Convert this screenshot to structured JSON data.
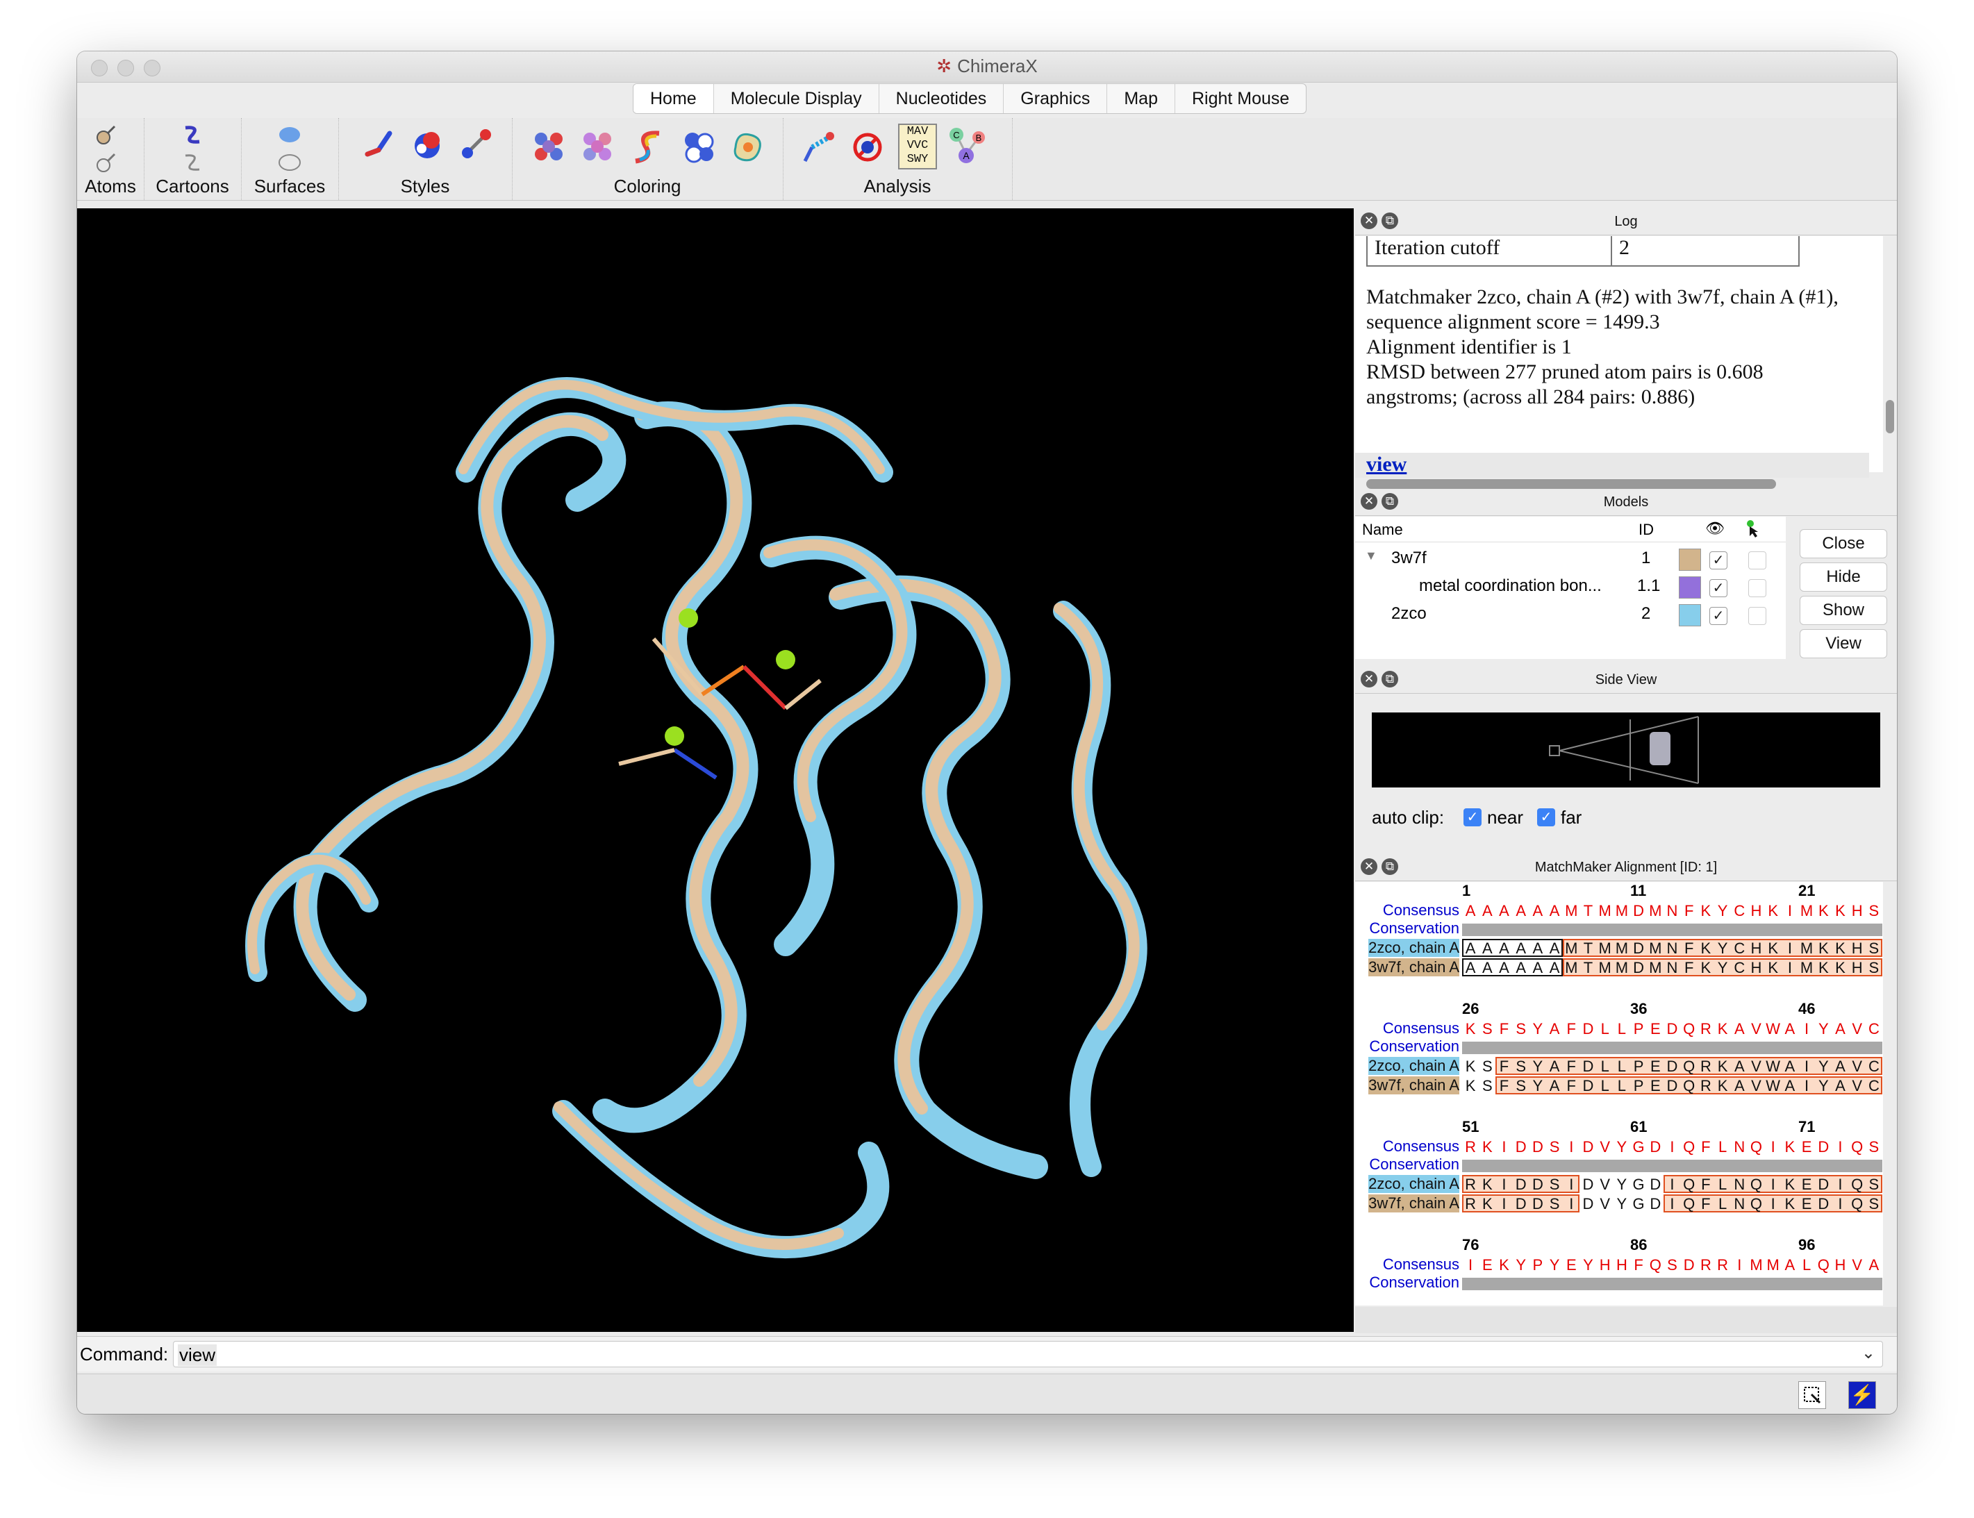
{
  "window": {
    "title": "ChimeraX"
  },
  "tabs": [
    "Home",
    "Molecule Display",
    "Nucleotides",
    "Graphics",
    "Map",
    "Right Mouse"
  ],
  "toolbar": {
    "groups": [
      {
        "label": "Atoms"
      },
      {
        "label": "Cartoons"
      },
      {
        "label": "Surfaces"
      },
      {
        "label": "Styles"
      },
      {
        "label": "Coloring"
      },
      {
        "label": "Analysis"
      }
    ],
    "seqview_icon_text": [
      "MAV",
      "VVC",
      "SWY"
    ],
    "chain_icon_labels": [
      "C",
      "B",
      "A"
    ]
  },
  "log": {
    "title": "Log",
    "table_row": {
      "label": "Iteration cutoff",
      "value": "2"
    },
    "lines": [
      "Matchmaker 2zco, chain A (#2) with 3w7f, chain A (#1),",
      "sequence alignment score = 1499.3",
      "Alignment identifier is 1",
      "RMSD between 277 pruned atom pairs is 0.608",
      "angstroms; (across all 284 pairs: 0.886)"
    ],
    "link": "view"
  },
  "models": {
    "title": "Models",
    "headers": {
      "name": "Name",
      "id": "ID"
    },
    "rows": [
      {
        "name": "3w7f",
        "id": "1",
        "color": "#d2b48c",
        "shown": true
      },
      {
        "name": "metal coordination bon...",
        "id": "1.1",
        "color": "#9370db",
        "shown": true
      },
      {
        "name": "2zco",
        "id": "2",
        "color": "#87ceeb",
        "shown": true
      }
    ],
    "buttons": [
      "Close",
      "Hide",
      "Show",
      "View"
    ]
  },
  "sideview": {
    "title": "Side View",
    "autoclip_label": "auto clip:",
    "near_label": "near",
    "far_label": "far",
    "near": true,
    "far": true
  },
  "alignment": {
    "title": "MatchMaker Alignment [ID: 1]",
    "row_labels": {
      "consensus": "Consensus",
      "conservation": "Conservation",
      "seq1": "2zco, chain A",
      "seq2": "3w7f, chain A"
    },
    "blocks": [
      {
        "numbers": [
          "1",
          "11",
          "21"
        ],
        "consensus": "AAAAAAMTMMDMNFKYCHKIMKKHS",
        "seq": "AAAAAAMTMMDMNFKYCHKIMKKHS"
      },
      {
        "numbers": [
          "26",
          "36",
          "46"
        ],
        "consensus": "KSFSYAFDLLPEDQRKAVWAIYAVC",
        "seq": "KSFSYAFDLLPEDQRKAVWAIYAVC"
      },
      {
        "numbers": [
          "51",
          "61",
          "71"
        ],
        "consensus": "RKIDDSIDVYGDIQFLNQIKEDIQS",
        "seq": "RKIDDSIDVYGDIQFLNQIKEDIQS"
      },
      {
        "numbers": [
          "76",
          "86",
          "96"
        ],
        "consensus": "IEKYPYEYHHFQSDRRIMMALQHVA",
        "seq": ""
      }
    ],
    "colors": {
      "consensus_label": "#0000cc",
      "consensus_seq": "#e60000",
      "seq1_bg": "#87ceeb",
      "seq2_bg": "#d2b48c",
      "highlight": "#fcdcc8",
      "highlight_border": "#e05020"
    }
  },
  "command": {
    "label": "Command:",
    "value": "view"
  }
}
